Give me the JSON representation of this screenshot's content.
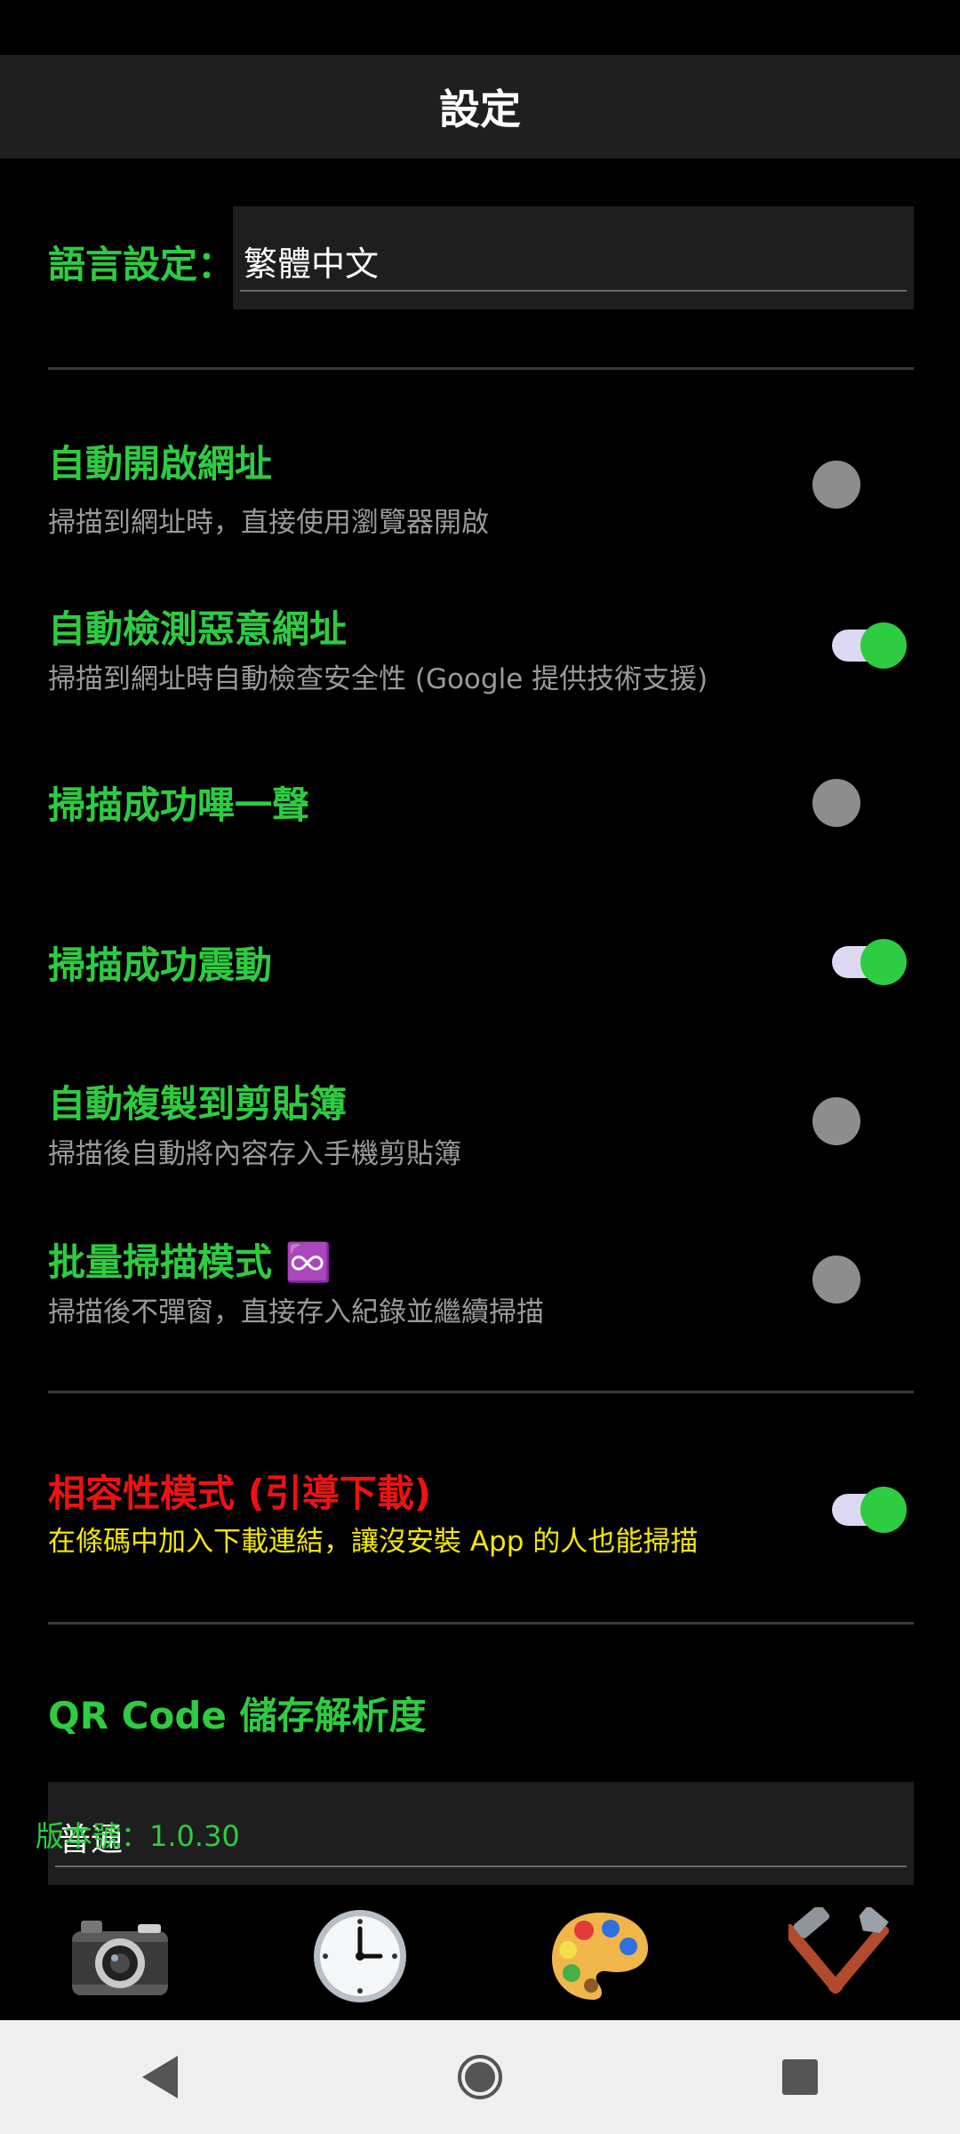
{
  "header": {
    "title": "設定"
  },
  "language": {
    "label": "語言設定：",
    "selected": "繁體中文"
  },
  "settings": [
    {
      "title": "自動開啟網址",
      "subtitle": "掃描到網址時，直接使用瀏覽器開啟",
      "enabled": false
    },
    {
      "title": "自動檢測惡意網址",
      "subtitle": "掃描到網址時自動檢查安全性 (Google 提供技術支援)",
      "enabled": true
    },
    {
      "title": "掃描成功嗶一聲",
      "subtitle": "",
      "enabled": false
    },
    {
      "title": "掃描成功震動",
      "subtitle": "",
      "enabled": true
    },
    {
      "title": "自動複製到剪貼簿",
      "subtitle": "掃描後自動將內容存入手機剪貼簿",
      "enabled": false
    },
    {
      "title": "批量掃描模式 ♾️",
      "subtitle": "掃描後不彈窗，直接存入紀錄並繼續掃描",
      "enabled": false
    }
  ],
  "compat": {
    "title": "相容性模式 (引導下載)",
    "subtitle": "在條碼中加入下載連結，讓沒安裝 App 的人也能掃描",
    "enabled": true
  },
  "resolution": {
    "title": "QR Code 儲存解析度",
    "selected": "普通"
  },
  "version": "版本號：1.0.30",
  "bottom_nav": [
    {
      "icon": "camera-icon"
    },
    {
      "icon": "clock-icon"
    },
    {
      "icon": "palette-icon"
    },
    {
      "icon": "tools-icon"
    }
  ],
  "system_nav": [
    "back-icon",
    "home-icon",
    "recents-icon"
  ],
  "colors": {
    "accent_green": "#2ecc40",
    "warning_red": "#ee1111",
    "note_yellow": "#f5e800",
    "switch_track_on": "#ddd8f2",
    "switch_off": "#8d8d8d"
  }
}
